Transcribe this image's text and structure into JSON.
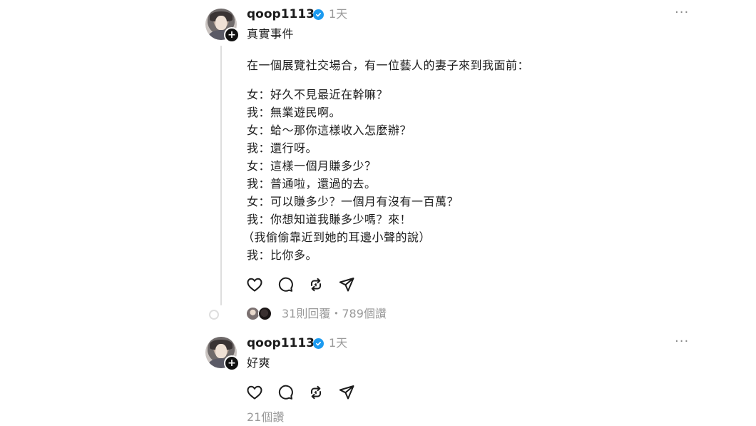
{
  "posts": [
    {
      "username": "qoop1113",
      "time": "1天",
      "more": "···",
      "title": "真實事件",
      "intro": "在一個展覽社交場合，有一位藝人的妻子來到我面前：",
      "lines": [
        "女：好久不見最近在幹嘛？",
        "我：無業遊民啊。",
        "女：蛤～那你這樣收入怎麼辦？",
        "我：還行呀。",
        "女：這樣一個月賺多少？",
        "我：普通啦，還過的去。",
        "女：可以賺多少？一個月有沒有一百萬？",
        "我：你想知道我賺多少嗎？來！",
        "（我偷偷靠近到她的耳邊小聲的說）",
        "我：比你多。"
      ],
      "stats": "31則回覆・789個讚"
    },
    {
      "username": "qoop1113",
      "time": "1天",
      "more": "···",
      "title": "好爽",
      "stats": "21個讚"
    }
  ],
  "icons": {
    "like": "heart-icon",
    "comment": "comment-icon",
    "repost": "repost-icon",
    "share": "send-icon",
    "verified": "verified-badge-icon",
    "follow": "plus-icon"
  },
  "colors": {
    "verified": "#1d9bf0",
    "text": "#1c1c1c",
    "muted": "#9a9a9a",
    "thread_line": "#dedede"
  }
}
